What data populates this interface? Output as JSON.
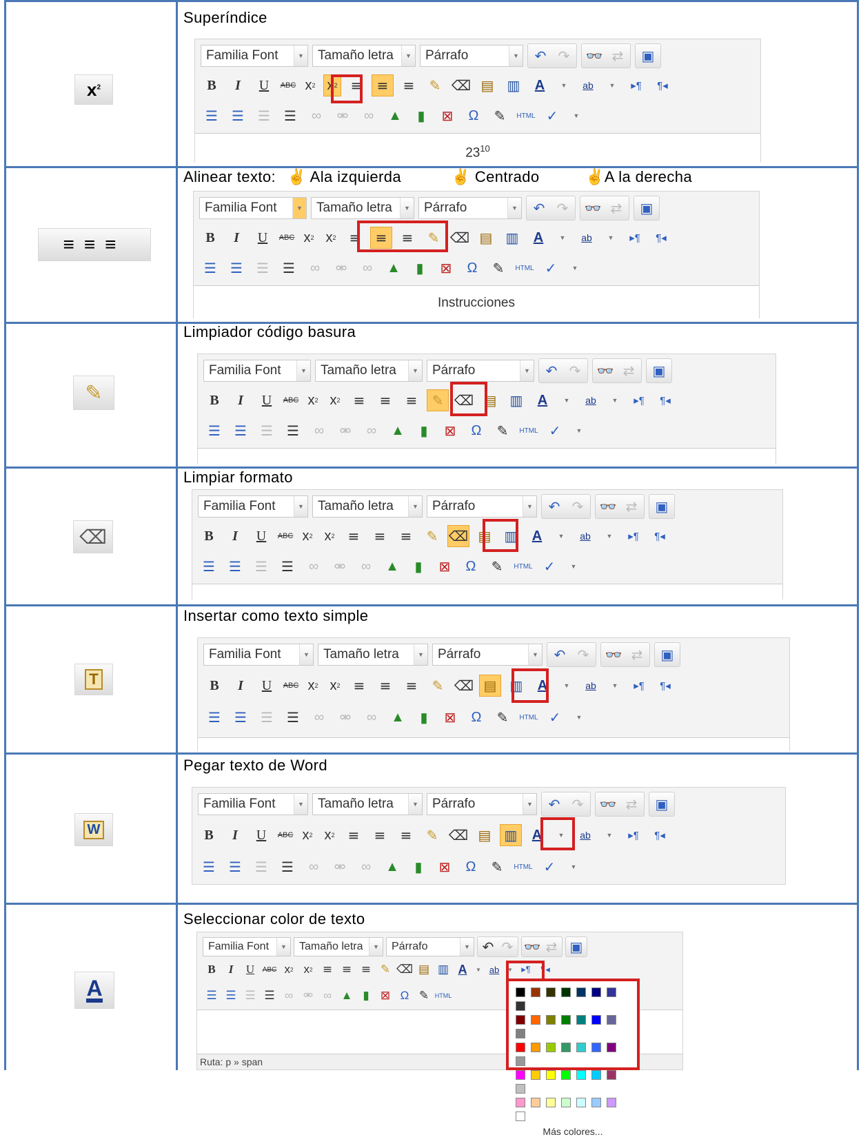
{
  "toolbar": {
    "font_family": "Familia Font",
    "font_size": "Tamaño letra",
    "format": "Párrafo",
    "html_label": "HTML",
    "abc_label": "ABC",
    "ab_label": "ab"
  },
  "rows": [
    {
      "title": "Superíndice",
      "content_base": "23",
      "content_sup": "10",
      "icon": "superscript-icon"
    },
    {
      "title": "Alinear  texto:",
      "align_left": "Ala izquierda",
      "align_center": "Centrado",
      "align_right": "A la derecha",
      "content": "Instrucciones",
      "icon": "align-icons"
    },
    {
      "title": "Limpiador  código basura",
      "icon": "cleanup-brush-icon"
    },
    {
      "title": "Limpiar  formato",
      "icon": "eraser-icon"
    },
    {
      "title": "Insertar  como  texto  simple",
      "icon": "paste-text-icon"
    },
    {
      "title": "Pegar texto de Word",
      "icon": "paste-word-icon"
    },
    {
      "title": "Seleccionar  color de texto",
      "icon": "text-color-icon",
      "path_label": "Ruta: p » span",
      "more_colors": "Más colores..."
    }
  ],
  "palette": [
    [
      "#000000",
      "#993300",
      "#333300",
      "#003300",
      "#003366",
      "#000080",
      "#333399",
      "#333333"
    ],
    [
      "#800000",
      "#ff6600",
      "#808000",
      "#008000",
      "#008080",
      "#0000ff",
      "#666699",
      "#808080"
    ],
    [
      "#ff0000",
      "#ff9900",
      "#99cc00",
      "#339966",
      "#33cccc",
      "#3366ff",
      "#800080",
      "#999999"
    ],
    [
      "#ff00ff",
      "#ffcc00",
      "#ffff00",
      "#00ff00",
      "#00ffff",
      "#00ccff",
      "#993366",
      "#c0c0c0"
    ],
    [
      "#ff99cc",
      "#ffcc99",
      "#ffff99",
      "#ccffcc",
      "#ccffff",
      "#99ccff",
      "#cc99ff",
      "#ffffff"
    ]
  ]
}
